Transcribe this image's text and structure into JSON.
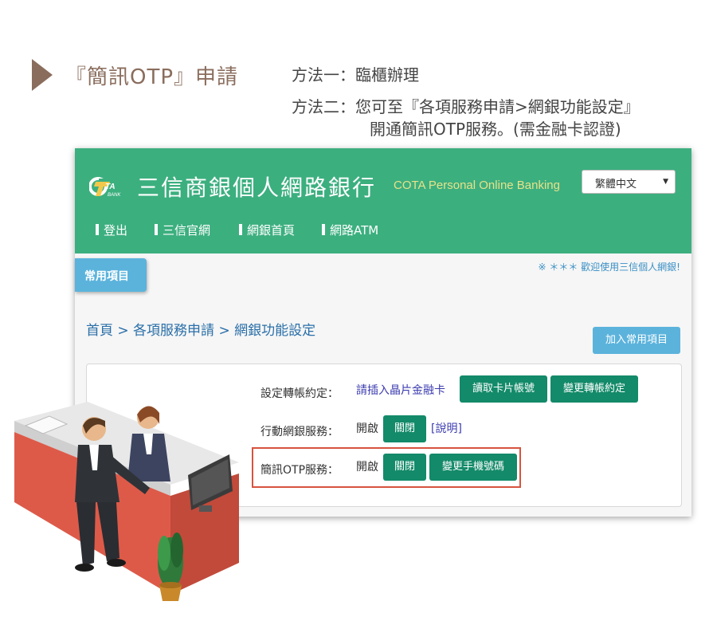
{
  "heading": {
    "title": "『簡訊OTP』申請",
    "method1": "方法一：臨櫃辦理",
    "method2_line1": "方法二：您可至『各項服務申請>網銀功能設定』",
    "method2_line2": "開通簡訊OTP服務。(需金融卡認證)"
  },
  "bank": {
    "logo_text": "COTA",
    "logo_sub": "BANK",
    "name": "三信商銀個人網路銀行",
    "name_en": "COTA Personal Online Banking",
    "language": "繁體中文"
  },
  "nav": {
    "items": [
      "登出",
      "三信官網",
      "網銀首頁",
      "網路ATM"
    ]
  },
  "favorites": {
    "tab_label": "常用項目",
    "add_label": "加入常用項目"
  },
  "welcome": "※ ＊＊＊ 歡迎使用三信個人網銀!",
  "breadcrumb": "首頁 > 各項服務申請 > 網銀功能設定",
  "settings": {
    "transfer": {
      "label": "設定轉帳約定：",
      "card_prompt": "請插入晶片金融卡",
      "read_btn": "讀取卡片帳號",
      "change_btn": "變更轉帳約定"
    },
    "mobile": {
      "label": "行動網銀服務：",
      "status": "開啟",
      "close_btn": "關閉",
      "info_link": "[說明]"
    },
    "otp": {
      "label": "簡訊OTP服務：",
      "status": "開啟",
      "close_btn": "關閉",
      "change_btn": "變更手機號碼"
    }
  },
  "colors": {
    "header": "#3caf7f",
    "button": "#138a69",
    "fav": "#5bb3dc",
    "highlight": "#d7533f"
  }
}
